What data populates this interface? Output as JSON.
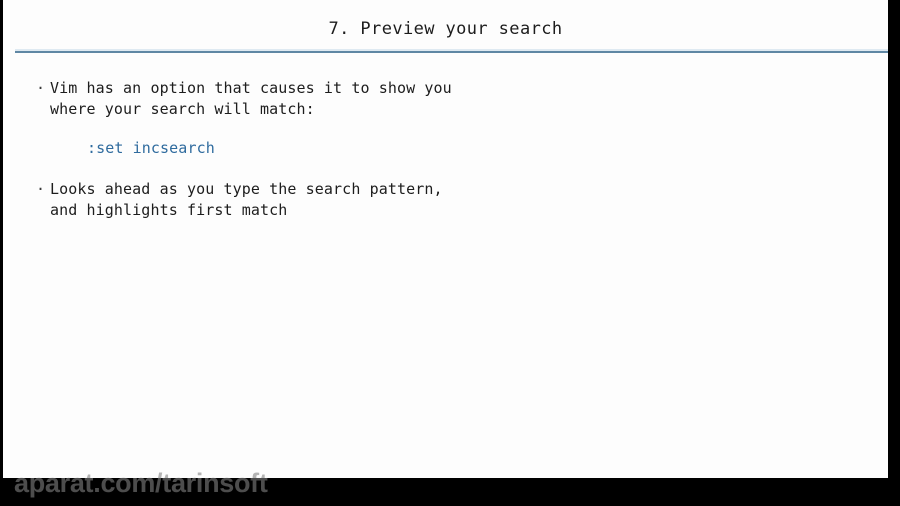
{
  "slide": {
    "title": "7. Preview your search",
    "title_color": "#1d1d1d",
    "rule_color": "#5f87a4",
    "background_color": "#fdfdfd",
    "bullet_glyph": "·",
    "bullets": [
      {
        "text": "Vim has an option that causes it to show you\nwhere your search will match:"
      },
      {
        "text": "Looks ahead as you type the search pattern,\nand highlights first match"
      }
    ],
    "code": {
      "text": ":set incsearch",
      "color": "#2f6b9e"
    }
  },
  "player": {
    "watermark": "aparat.com/tarinsoft",
    "letterbox_color": "#000000"
  }
}
